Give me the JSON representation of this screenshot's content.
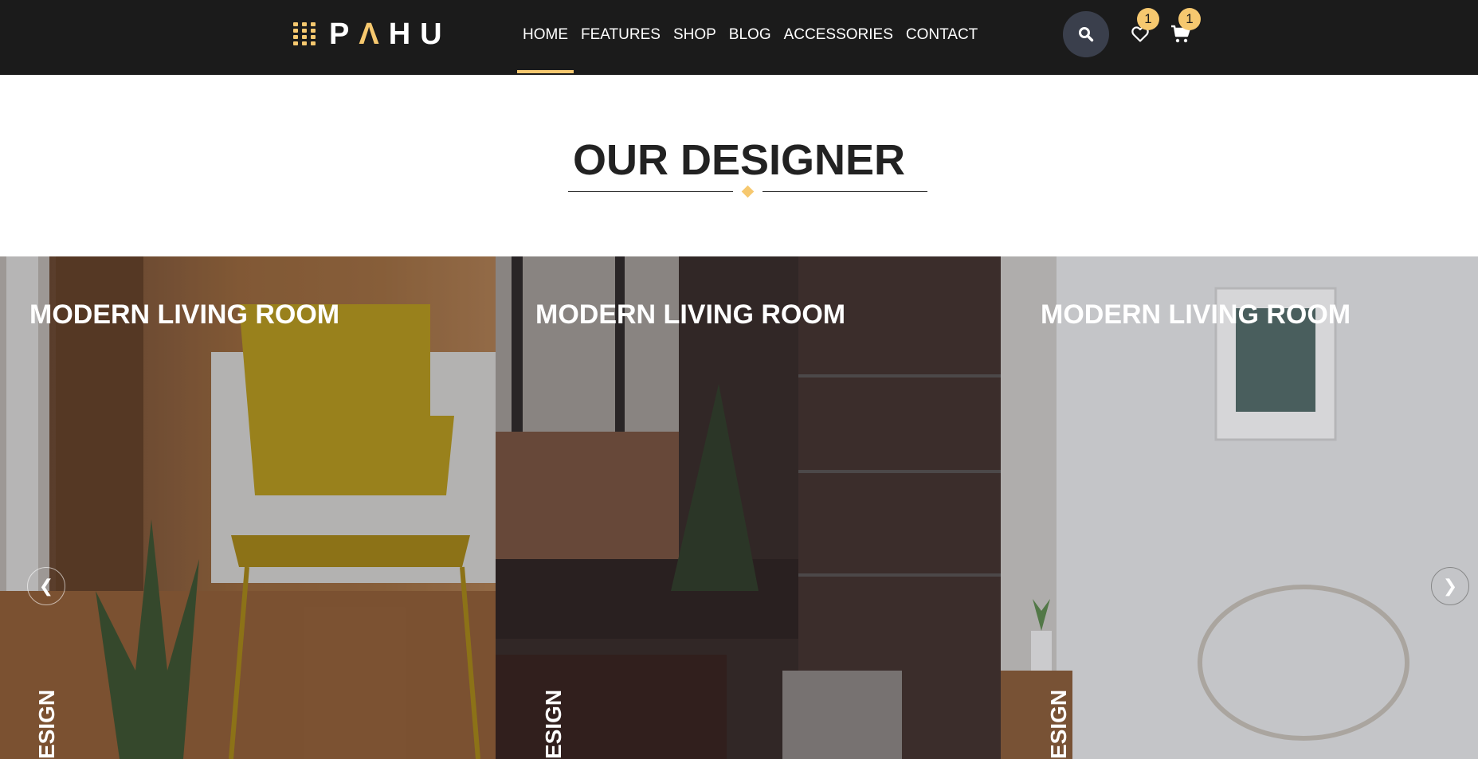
{
  "header": {
    "logo_text_1": "P",
    "logo_text_accent": "Λ",
    "logo_text_2": "HU",
    "nav": [
      {
        "label": "HOME",
        "active": true
      },
      {
        "label": "FEATURES"
      },
      {
        "label": "SHOP"
      },
      {
        "label": "BLOG"
      },
      {
        "label": "ACCESSORIES"
      },
      {
        "label": "CONTACT"
      }
    ],
    "wishlist_count": "1",
    "cart_count": "1",
    "icons": {
      "search": "search-icon",
      "wishlist": "heart-icon",
      "cart": "cart-icon"
    }
  },
  "section": {
    "title": "OUR DESIGNER"
  },
  "cards": [
    {
      "title": "MODERN LIVING ROOM",
      "vertical_label": "ESIGN"
    },
    {
      "title": "MODERN LIVING ROOM",
      "vertical_label": "ESIGN"
    },
    {
      "title": "MODERN LIVING ROOM",
      "vertical_label": "ESIGN"
    }
  ],
  "carousel": {
    "prev_label": "❮",
    "next_label": "❯"
  },
  "colors": {
    "accent": "#f6c86f",
    "header_bg": "#1b1b1b",
    "search_bg": "#3a3f4c",
    "title_text": "#222222"
  }
}
